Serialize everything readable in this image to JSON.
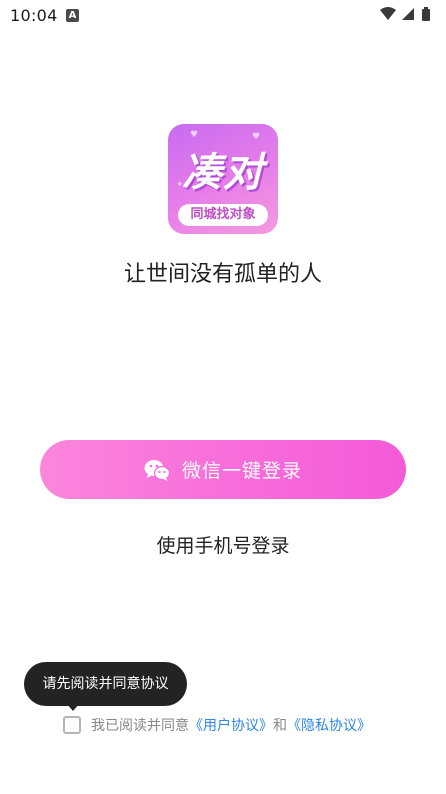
{
  "status_bar": {
    "time": "10:04",
    "notification_icon_letter": "A",
    "icons": [
      "wifi-icon",
      "signal-icon",
      "battery-icon"
    ]
  },
  "logo": {
    "title": "凑对",
    "badge": "同城找对象"
  },
  "slogan": "让世间没有孤单的人",
  "wechat_login": {
    "icon": "wechat-icon",
    "label": "微信一键登录"
  },
  "phone_login": {
    "label": "使用手机号登录"
  },
  "tooltip": {
    "text": "请先阅读并同意协议"
  },
  "agreement": {
    "checked": false,
    "prefix": "我已阅读并同意",
    "user_agreement": "《用户协议》",
    "connector": "和",
    "privacy_policy": "《隐私协议》"
  },
  "colors": {
    "button_gradient_start": "#fb86dc",
    "button_gradient_end": "#f45ad8",
    "link": "#2c86e8",
    "tooltip_bg": "#232323"
  }
}
